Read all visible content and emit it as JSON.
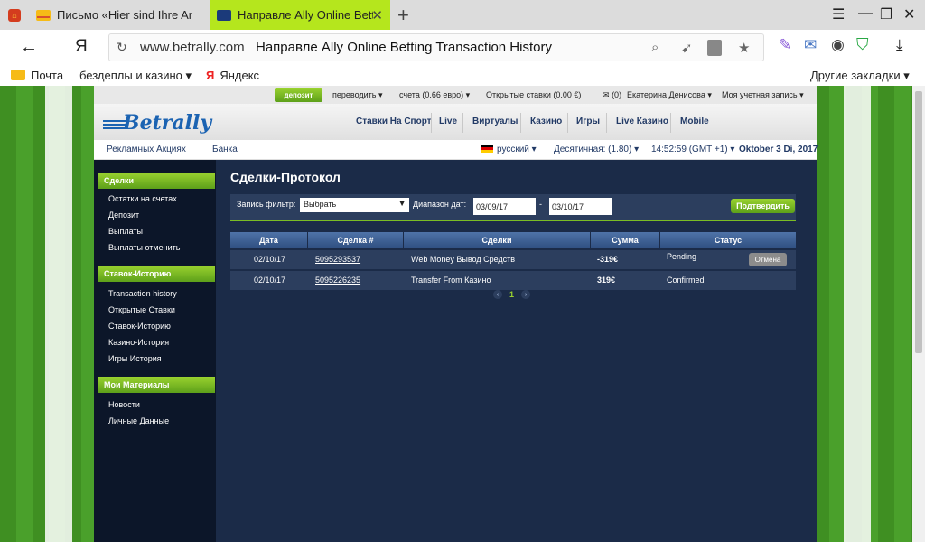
{
  "browser": {
    "tabs": [
      {
        "title": "Письмо «Hier sind Ihre Anm"
      },
      {
        "title": "Направле Ally Online Bett"
      }
    ],
    "address": {
      "domain": "www.betrally.com",
      "page_title": "Направле Ally Online Betting Transaction History"
    },
    "yandex_letter": "Я",
    "bookmarks": {
      "items": [
        "Почта",
        "бездеплы и казино ▾",
        "Яндекс"
      ],
      "other": "Другие закладки ▾"
    }
  },
  "site": {
    "logo": "Betrally",
    "topbar": {
      "deposit": "депозит",
      "transfer": "переводить ▾",
      "account": "счета (0.66 евро) ▾",
      "open_bets": "Открытые ставки (0.00 €)",
      "messages": "(0)",
      "user": "Екатерина Денисова ▾",
      "my_account": "Моя учетная запись ▾"
    },
    "main_nav": [
      "Ставки На Спорт",
      "Live",
      "Виртуалы",
      "Казино",
      "Игры",
      "Live Казино",
      "Mobile"
    ],
    "sub_nav": {
      "promotions": "Рекламных Акциях",
      "bank": "Банка",
      "language": "русский ▾",
      "odds": "Десятичная: (1.80) ▾",
      "time": "14:52:59 (GMT +1) ▾",
      "date": "Oktober 3 Di, 2017"
    },
    "sidebar": [
      {
        "heading": "Сделки",
        "items": [
          "Остатки на счетах",
          "Депозит",
          "Выплаты",
          "Выплаты отменить"
        ]
      },
      {
        "heading": "Ставок-Историю",
        "items": [
          "Transaction history",
          "Открытые Ставки",
          "Ставок-Историю",
          "Казино-История",
          "Игры История"
        ]
      },
      {
        "heading": "Мои Материалы",
        "items": [
          "Новости",
          "Личные Данные"
        ]
      }
    ],
    "content": {
      "title": "Сделки-Протокол",
      "filter": {
        "label": "Запись фильтр:",
        "selected": "Выбрать",
        "range_label": "Диапазон дат:",
        "from": "03/09/17",
        "dash": "-",
        "to": "03/10/17",
        "confirm": "Подтвердить"
      },
      "table": {
        "headers": [
          "Дата",
          "Сделка #",
          "Сделки",
          "Сумма",
          "Статус"
        ],
        "rows": [
          {
            "date": "02/10/17",
            "id": "5095293537",
            "desc": "Web Money Вывод Средств",
            "amount": "-319€",
            "status": "Pending",
            "action": "Отмена"
          },
          {
            "date": "02/10/17",
            "id": "5095226235",
            "desc": "Transfer From Казино",
            "amount": "319€",
            "status": "Confirmed"
          }
        ]
      },
      "pager": {
        "prev": "‹",
        "page": "1",
        "next": "›"
      }
    }
  }
}
